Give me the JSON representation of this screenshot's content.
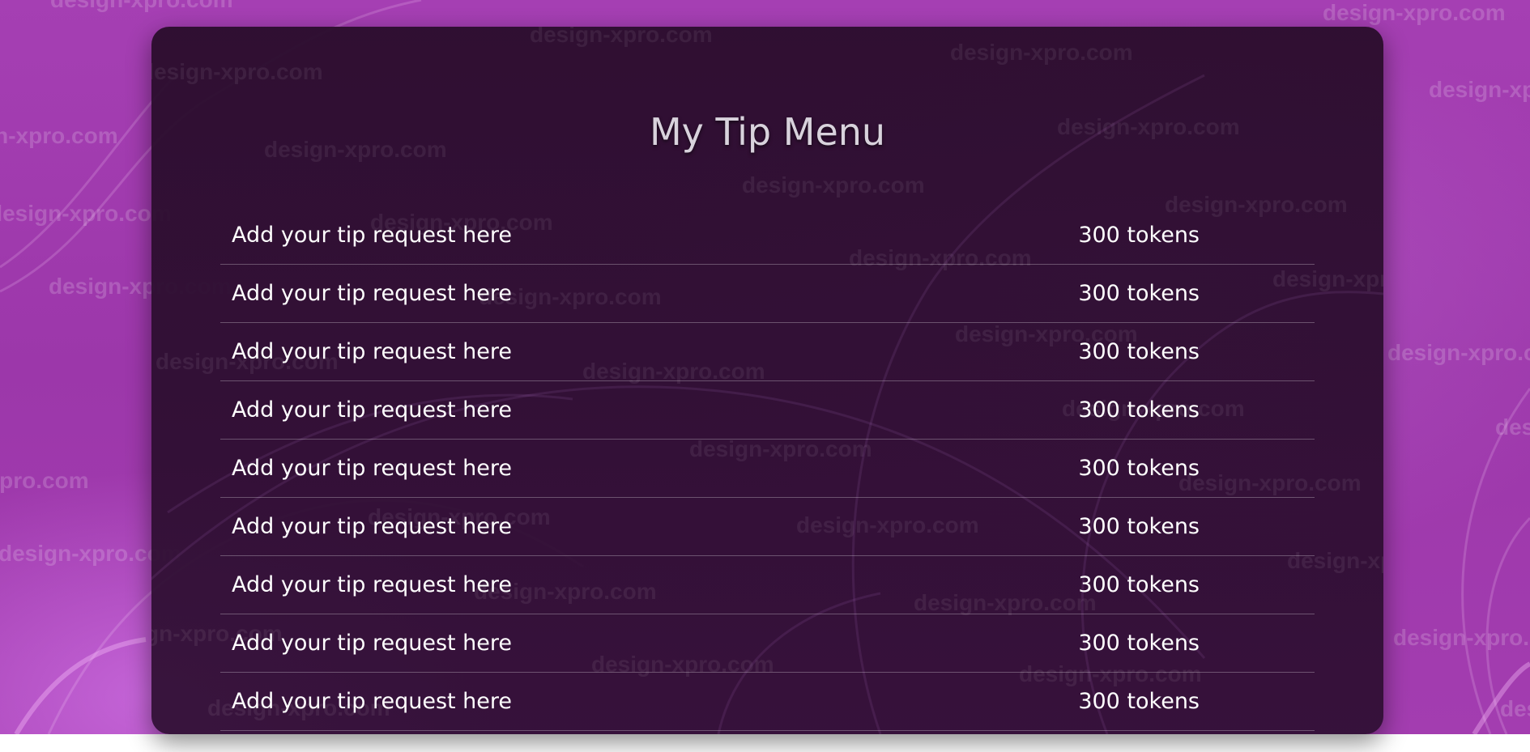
{
  "watermark_text": "design-xpro.com",
  "colors": {
    "background": "#a53fb3",
    "panel": "#2c0d2f",
    "text": "#ffffff",
    "title": "#d8d2dc"
  },
  "tip_menu": {
    "title": "My Tip Menu",
    "items": [
      {
        "request": "Add your tip request here",
        "price": "300 tokens"
      },
      {
        "request": "Add your tip request here",
        "price": "300 tokens"
      },
      {
        "request": "Add your tip request here",
        "price": "300 tokens"
      },
      {
        "request": "Add your tip request here",
        "price": "300 tokens"
      },
      {
        "request": "Add your tip request here",
        "price": "300 tokens"
      },
      {
        "request": "Add your tip request here",
        "price": "300 tokens"
      },
      {
        "request": "Add your tip request here",
        "price": "300 tokens"
      },
      {
        "request": "Add your tip request here",
        "price": "300 tokens"
      },
      {
        "request": "Add your tip request here",
        "price": "300 tokens"
      }
    ]
  }
}
